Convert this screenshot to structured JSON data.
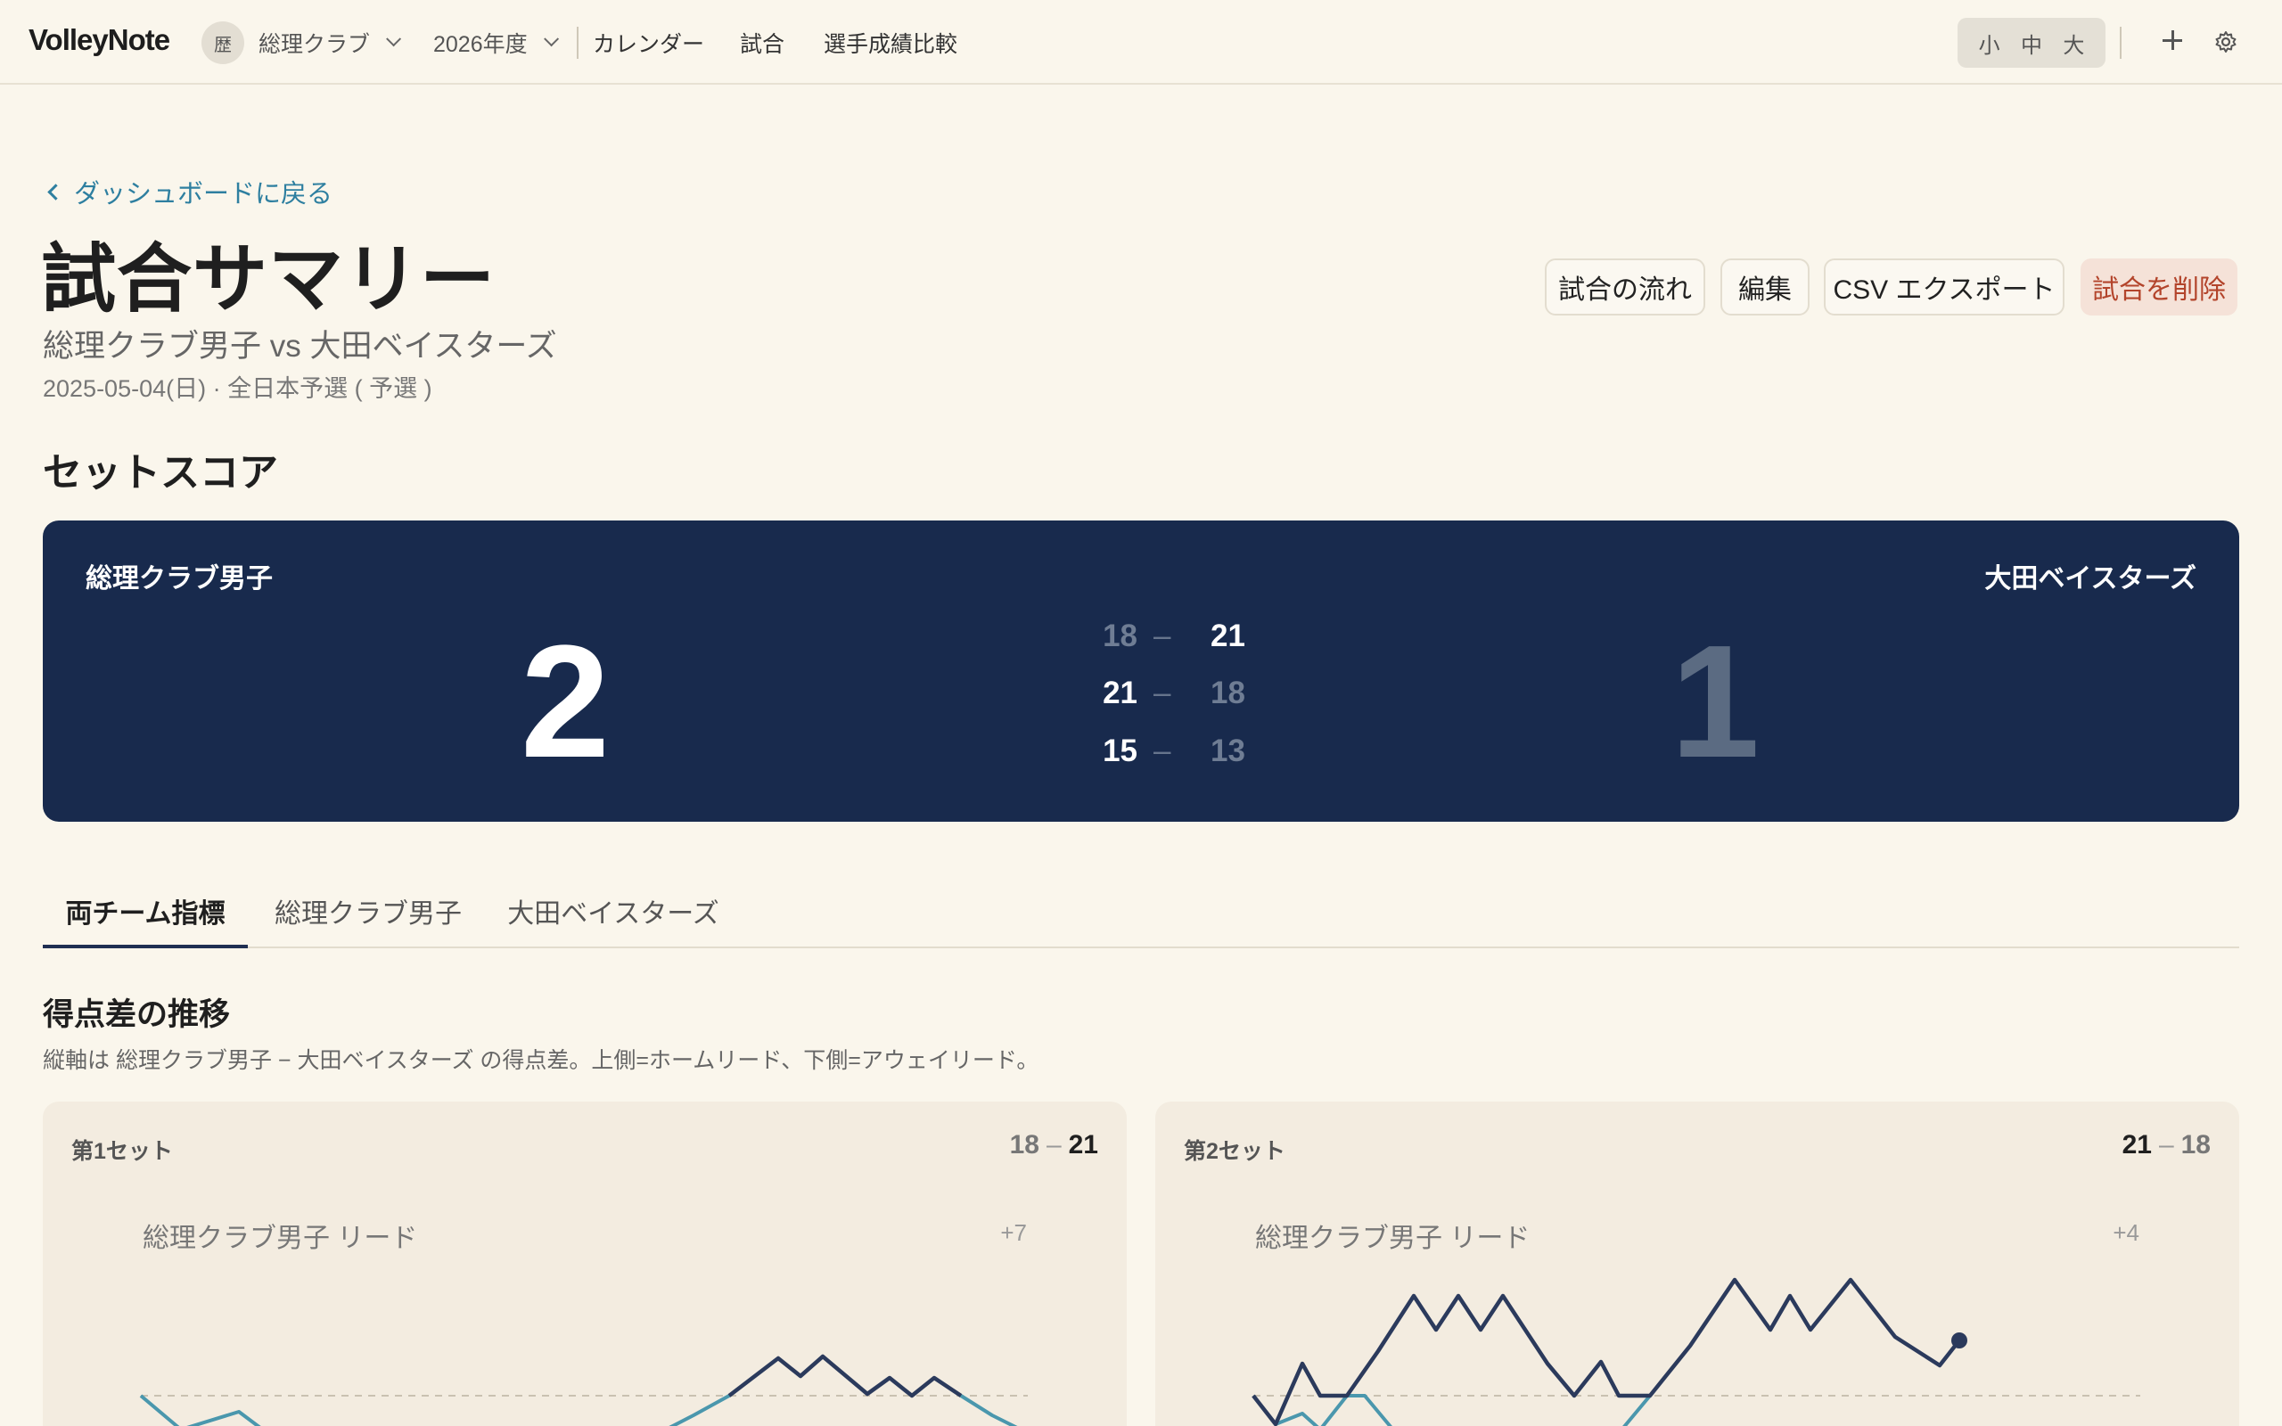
{
  "topbar": {
    "logo": "VolleyNote",
    "club_badge": "歴",
    "club_name": "総理クラブ",
    "season": "2026年度",
    "nav": [
      "カレンダー",
      "試合",
      "選手成績比較"
    ],
    "font_sizes": [
      "小",
      "中",
      "大"
    ]
  },
  "header": {
    "back_label": "ダッシュボードに戻る",
    "title": "試合サマリー",
    "matchup": "総理クラブ男子 vs 大田ベイスターズ",
    "meta": "2025-05-04(日) · 全日本予選 ( 予選 )",
    "actions": [
      "試合の流れ",
      "編集",
      "CSV エクスポート",
      "試合を削除"
    ]
  },
  "set_score": {
    "heading": "セットスコア",
    "home_team": "総理クラブ男子",
    "away_team": "大田ベイスターズ",
    "home_sets": "2",
    "away_sets": "1",
    "sets": [
      {
        "home": "18",
        "away": "21"
      },
      {
        "home": "21",
        "away": "18"
      },
      {
        "home": "15",
        "away": "13"
      }
    ],
    "dash": "–"
  },
  "tabs": [
    "両チーム指標",
    "総理クラブ男子",
    "大田ベイスターズ"
  ],
  "diff_section": {
    "heading": "得点差の推移",
    "description": "縦軸は 総理クラブ男子 − 大田ベイスターズ の得点差。上側=ホームリード、下側=アウェイリード。"
  },
  "cards": [
    {
      "title": "第1セット",
      "home": "18",
      "away": "21",
      "lead_label": "総理クラブ男子 リード",
      "max_label": "+7"
    },
    {
      "title": "第2セット",
      "home": "21",
      "away": "18",
      "lead_label": "総理クラブ男子 リード",
      "max_label": "+4"
    }
  ],
  "colors": {
    "navy": "#182a4d",
    "line_home": "#2b3a5c",
    "line_away": "#4a97ad",
    "link": "#2e7fa0",
    "danger": "#b3442b"
  }
}
